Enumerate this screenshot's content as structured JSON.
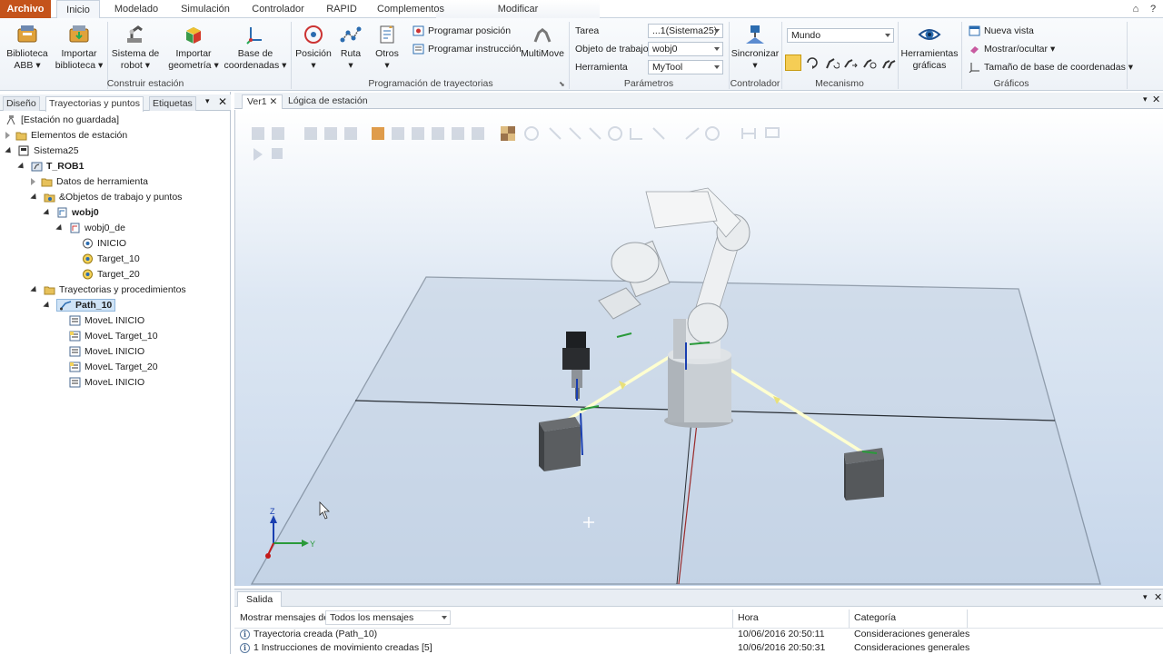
{
  "ribbon_tabs": [
    "Archivo",
    "Inicio",
    "Modelado",
    "Simulación",
    "Controlador",
    "RAPID",
    "Complementos",
    "Modificar"
  ],
  "groups": {
    "construir": {
      "label": "Construir estación",
      "biblioteca": "Biblioteca ABB",
      "importar_biblioteca": "Importar biblioteca",
      "sistema_robot": "Sistema de robot",
      "importar_geometria": "Importar geometría",
      "base_coordenadas": "Base de coordenadas"
    },
    "programacion": {
      "label": "Programación de trayectorias",
      "posicion": "Posición",
      "ruta": "Ruta",
      "otros": "Otros",
      "programar_posicion": "Programar posición",
      "programar_instruccion": "Programar instrucción",
      "multimove": "MultiMove"
    },
    "parametros": {
      "label": "Parámetros",
      "tarea_label": "Tarea",
      "tarea_value": "...1(Sistema25)",
      "objeto_label": "Objeto de trabajo",
      "objeto_value": "wobj0",
      "herramienta_label": "Herramienta",
      "herramienta_value": "MyTool"
    },
    "controlador": {
      "label": "Controlador",
      "sincronizar": "Sincronizar"
    },
    "mecanismo": {
      "label": "Mecanismo",
      "mundo": "Mundo"
    },
    "herramientas": {
      "label": "Herramientas gráficas"
    },
    "graficos": {
      "label": "Gráficos",
      "nueva_vista": "Nueva vista",
      "mostrar_ocultar": "Mostrar/ocultar",
      "tamano_base": "Tamaño de base de coordenadas"
    }
  },
  "left_panel": {
    "tabs": [
      "Diseño",
      "Trayectorias y puntos",
      "Etiquetas"
    ],
    "tree": [
      "[Estación no guardada]",
      "Elementos de estación",
      "Sistema25",
      "T_ROB1",
      "Datos de herramienta",
      "&Objetos de trabajo y puntos",
      "wobj0",
      "wobj0_de",
      "INICIO",
      "Target_10",
      "Target_20",
      "Trayectorias y procedimientos",
      "Path_10",
      "MoveL INICIO",
      "MoveL Target_10",
      "MoveL INICIO",
      "MoveL Target_20",
      "MoveL INICIO"
    ]
  },
  "viewport": {
    "tabs": [
      "Ver1",
      "Lógica de estación"
    ],
    "axis_y": "Y",
    "axis_z": "Z"
  },
  "output": {
    "tab": "Salida",
    "filter_label": "Mostrar mensajes de:",
    "filter_value": "Todos los mensajes",
    "col_hora": "Hora",
    "col_categoria": "Categoría",
    "rows": [
      {
        "msg": "Trayectoria creada (Path_10)",
        "hora": "10/06/2016 20:50:11",
        "cat": "Consideraciones generales"
      },
      {
        "msg": "1 Instrucciones de movimiento creadas [5]",
        "hora": "10/06/2016 20:50:31",
        "cat": "Consideraciones generales"
      }
    ]
  },
  "colors": {
    "file_tab": "#c4531b",
    "accent": "#2b6cb0"
  }
}
